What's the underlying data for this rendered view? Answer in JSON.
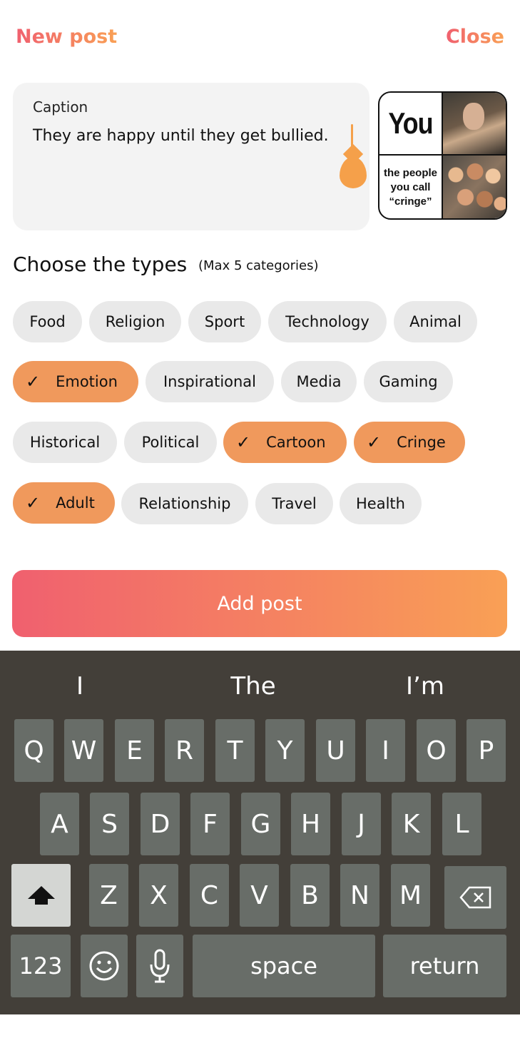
{
  "header": {
    "title": "New post",
    "close_label": "Close"
  },
  "caption": {
    "label": "Caption",
    "value": "They are happy until they get bullied."
  },
  "thumbnail": {
    "top_text": "You",
    "bottom_text_lines": [
      "the people",
      "you call",
      "“cringe”"
    ]
  },
  "types": {
    "heading": "Choose the types",
    "subheading": "(Max 5 categories)",
    "chips": [
      {
        "label": "Food",
        "selected": false
      },
      {
        "label": "Religion",
        "selected": false
      },
      {
        "label": "Sport",
        "selected": false
      },
      {
        "label": "Technology",
        "selected": false
      },
      {
        "label": "Animal",
        "selected": false
      },
      {
        "label": "Emotion",
        "selected": true
      },
      {
        "label": "Inspirational",
        "selected": false
      },
      {
        "label": "Media",
        "selected": false
      },
      {
        "label": "Gaming",
        "selected": false
      },
      {
        "label": "Historical",
        "selected": false
      },
      {
        "label": "Political",
        "selected": false
      },
      {
        "label": "Cartoon",
        "selected": true
      },
      {
        "label": "Cringe",
        "selected": true
      },
      {
        "label": "Adult",
        "selected": true
      },
      {
        "label": "Relationship",
        "selected": false
      },
      {
        "label": "Travel",
        "selected": false
      },
      {
        "label": "Health",
        "selected": false
      }
    ]
  },
  "actions": {
    "add_post_label": "Add post"
  },
  "colors": {
    "gradient_start": "#f0606f",
    "gradient_end": "#f9a055",
    "chip_selected": "#f0995c",
    "chip_default": "#e9e9e9",
    "keyboard_bg": "#433f39"
  },
  "keyboard": {
    "suggestions": [
      "I",
      "The",
      "I’m"
    ],
    "row1": [
      "Q",
      "W",
      "E",
      "R",
      "T",
      "Y",
      "U",
      "I",
      "O",
      "P"
    ],
    "row2": [
      "A",
      "S",
      "D",
      "F",
      "G",
      "H",
      "J",
      "K",
      "L"
    ],
    "row3": [
      "Z",
      "X",
      "C",
      "V",
      "B",
      "N",
      "M"
    ],
    "shift_icon": "shift-arrow-icon",
    "backspace_icon": "backspace-icon",
    "numbers_label": "123",
    "emoji_icon": "emoji-icon",
    "mic_icon": "microphone-icon",
    "space_label": "space",
    "return_label": "return"
  }
}
